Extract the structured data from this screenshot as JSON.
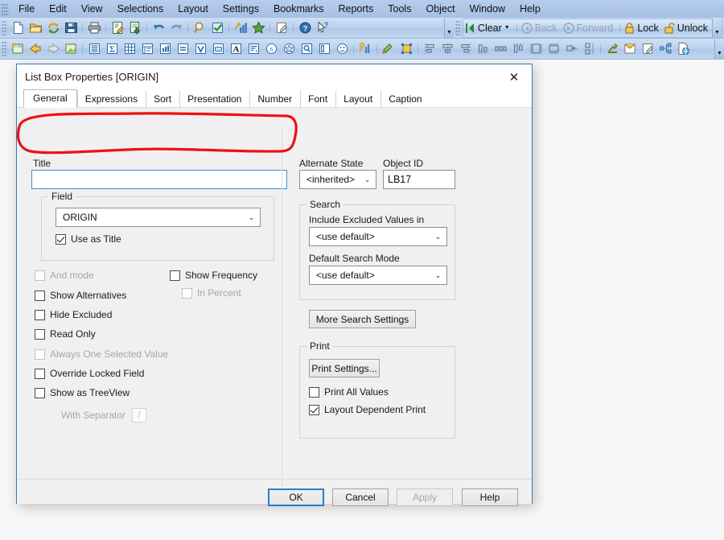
{
  "menubar": {
    "items": [
      {
        "label": "File"
      },
      {
        "label": "Edit"
      },
      {
        "label": "View"
      },
      {
        "label": "Selections"
      },
      {
        "label": "Layout"
      },
      {
        "label": "Settings"
      },
      {
        "label": "Bookmarks"
      },
      {
        "label": "Reports"
      },
      {
        "label": "Tools"
      },
      {
        "label": "Object"
      },
      {
        "label": "Window"
      },
      {
        "label": "Help"
      }
    ]
  },
  "toolbar1": {
    "icons": [
      {
        "name": "new-document-icon"
      },
      {
        "name": "open-folder-icon"
      },
      {
        "name": "reload-icon"
      },
      {
        "name": "save-icon"
      },
      {
        "name": "print-icon"
      },
      {
        "name": "edit-script-icon"
      },
      {
        "name": "export-icon"
      },
      {
        "name": "undo-icon"
      },
      {
        "name": "redo-icon"
      },
      {
        "name": "search-icon"
      },
      {
        "name": "check-icon"
      },
      {
        "name": "chart-icon"
      },
      {
        "name": "star-icon"
      },
      {
        "name": "notes-icon"
      },
      {
        "name": "help-icon"
      },
      {
        "name": "context-help-icon"
      }
    ],
    "clear_label": "Clear",
    "back_label": "Back",
    "forward_label": "Forward",
    "lock_label": "Lock",
    "unlock_label": "Unlock"
  },
  "toolbar2": {
    "icons": [
      {
        "name": "new-sheet-icon"
      },
      {
        "name": "previous-sheet-icon"
      },
      {
        "name": "next-sheet-icon"
      },
      {
        "name": "sheet-properties-icon"
      },
      {
        "name": "list-box-icon"
      },
      {
        "name": "statistics-box-icon"
      },
      {
        "name": "table-box-icon"
      },
      {
        "name": "pivot-table-icon"
      },
      {
        "name": "bar-chart-icon"
      },
      {
        "name": "input-box-icon"
      },
      {
        "name": "multi-box-icon"
      },
      {
        "name": "button-icon"
      },
      {
        "name": "text-object-icon"
      },
      {
        "name": "current-selections-icon"
      },
      {
        "name": "slider-icon"
      },
      {
        "name": "bookmark-object-icon"
      },
      {
        "name": "search-object-icon"
      },
      {
        "name": "container-icon"
      },
      {
        "name": "custom-object-icon"
      },
      {
        "name": "settings-chart-icon"
      },
      {
        "name": "format-painter-icon"
      },
      {
        "name": "design-grid-icon"
      },
      {
        "name": "align-left-icon"
      },
      {
        "name": "align-center-h-icon"
      },
      {
        "name": "align-right-icon"
      },
      {
        "name": "align-bottom-icon"
      },
      {
        "name": "distribute-h-icon"
      },
      {
        "name": "align-top-icon"
      },
      {
        "name": "same-height-icon"
      },
      {
        "name": "same-width-icon"
      },
      {
        "name": "space-h-icon"
      },
      {
        "name": "space-v-icon"
      },
      {
        "name": "promote-icon"
      },
      {
        "name": "note-icon"
      },
      {
        "name": "edit-note-icon"
      },
      {
        "name": "share-icon"
      },
      {
        "name": "publish-icon"
      }
    ]
  },
  "dialog": {
    "title": "List Box Properties [ORIGIN]",
    "close_icon": "✕",
    "tabs": [
      {
        "label": "General",
        "active": true
      },
      {
        "label": "Expressions",
        "active": false
      },
      {
        "label": "Sort",
        "active": false
      },
      {
        "label": "Presentation",
        "active": false
      },
      {
        "label": "Number",
        "active": false
      },
      {
        "label": "Font",
        "active": false
      },
      {
        "label": "Layout",
        "active": false
      },
      {
        "label": "Caption",
        "active": false
      }
    ],
    "left": {
      "title_label": "Title",
      "title_value": "",
      "title_browse_label": "...",
      "field_group_label": "Field",
      "field_value": "ORIGIN",
      "use_as_title": {
        "label": "Use as Title",
        "checked": true,
        "enabled": true
      },
      "checkboxes": [
        {
          "label": "And mode",
          "checked": false,
          "enabled": false
        },
        {
          "label": "Show Alternatives",
          "checked": false,
          "enabled": true
        },
        {
          "label": "Hide Excluded",
          "checked": false,
          "enabled": true
        },
        {
          "label": "Read Only",
          "checked": false,
          "enabled": true
        },
        {
          "label": "Always One Selected Value",
          "checked": false,
          "enabled": false
        },
        {
          "label": "Override Locked Field",
          "checked": false,
          "enabled": true
        },
        {
          "label": "Show as TreeView",
          "checked": false,
          "enabled": true
        }
      ],
      "show_frequency": {
        "label": "Show Frequency",
        "checked": false,
        "enabled": true
      },
      "in_percent": {
        "label": "In Percent",
        "checked": false,
        "enabled": false
      },
      "with_separator_label": "With Separator",
      "with_separator_value": "/"
    },
    "right": {
      "alternate_state_label": "Alternate State",
      "alternate_state_value": "<inherited>",
      "object_id_label": "Object ID",
      "object_id_value": "LB17",
      "search_group_label": "Search",
      "include_excluded_label": "Include Excluded Values in Search",
      "include_excluded_value": "<use default>",
      "default_search_mode_label": "Default Search Mode",
      "default_search_mode_value": "<use default>",
      "more_search_settings_label": "More Search Settings",
      "print_group_label": "Print",
      "print_settings_label": "Print Settings...",
      "print_all_values": {
        "label": "Print All Values",
        "checked": false,
        "enabled": true
      },
      "layout_dependent_print": {
        "label": "Layout Dependent Print",
        "checked": true,
        "enabled": true
      }
    },
    "buttons": [
      {
        "label": "OK",
        "state": "default"
      },
      {
        "label": "Cancel",
        "state": "normal"
      },
      {
        "label": "Apply",
        "state": "disabled"
      },
      {
        "label": "Help",
        "state": "normal"
      }
    ]
  },
  "annotation": {
    "name": "red-highlight-around-title-field",
    "color": "#ee1111"
  }
}
